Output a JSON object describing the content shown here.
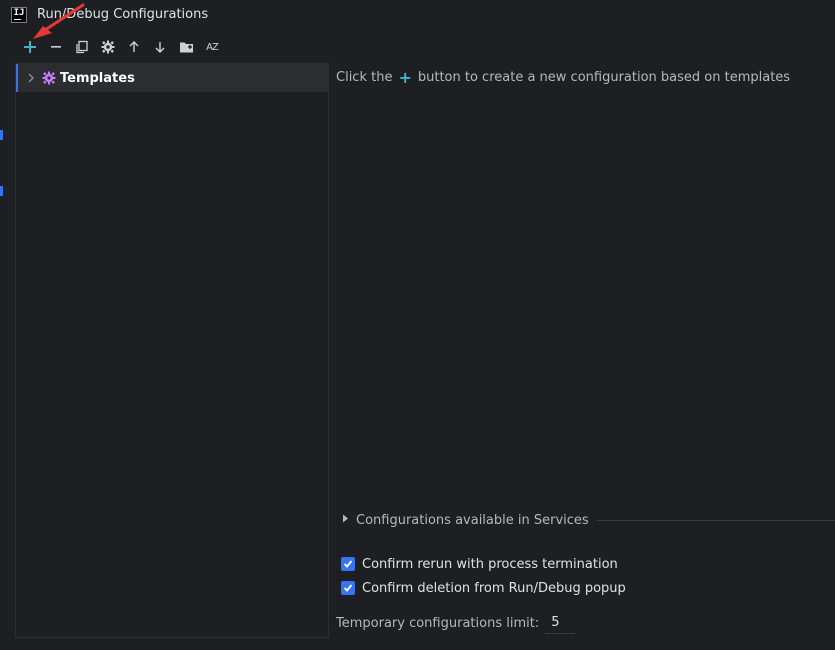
{
  "window": {
    "title": "Run/Debug Configurations",
    "logo_text": "IJ"
  },
  "toolbar": {
    "items": [
      {
        "name": "add",
        "icon": "plus-icon"
      },
      {
        "name": "remove",
        "icon": "minus-icon"
      },
      {
        "name": "copy",
        "icon": "copy-icon"
      },
      {
        "name": "settings",
        "icon": "gear-icon"
      },
      {
        "name": "move-up",
        "icon": "arrow-up-icon"
      },
      {
        "name": "move-down",
        "icon": "arrow-down-icon"
      },
      {
        "name": "new-folder",
        "icon": "folder-add-icon"
      },
      {
        "name": "sort",
        "icon": "sort-alpha-icon"
      }
    ],
    "sort_label": "AZ"
  },
  "tree": {
    "items": [
      {
        "label": "Templates",
        "icon": "gear-icon",
        "expanded": false,
        "selected": true
      }
    ]
  },
  "hint": {
    "before": "Click the",
    "plus": "+",
    "after": "button to create a new configuration based on templates"
  },
  "services": {
    "label": "Configurations available in Services"
  },
  "options": {
    "confirm_rerun": {
      "label": "Confirm rerun with process termination",
      "checked": true
    },
    "confirm_delete": {
      "label": "Confirm deletion from Run/Debug popup",
      "checked": true
    }
  },
  "limit": {
    "label": "Temporary configurations limit:",
    "value": "5"
  },
  "colors": {
    "background": "#1e1f22",
    "accent": "#3574f0",
    "plus_accent": "#3fb6c5",
    "template_icon": "#c77dff",
    "annotation_arrow": "#e53935"
  }
}
